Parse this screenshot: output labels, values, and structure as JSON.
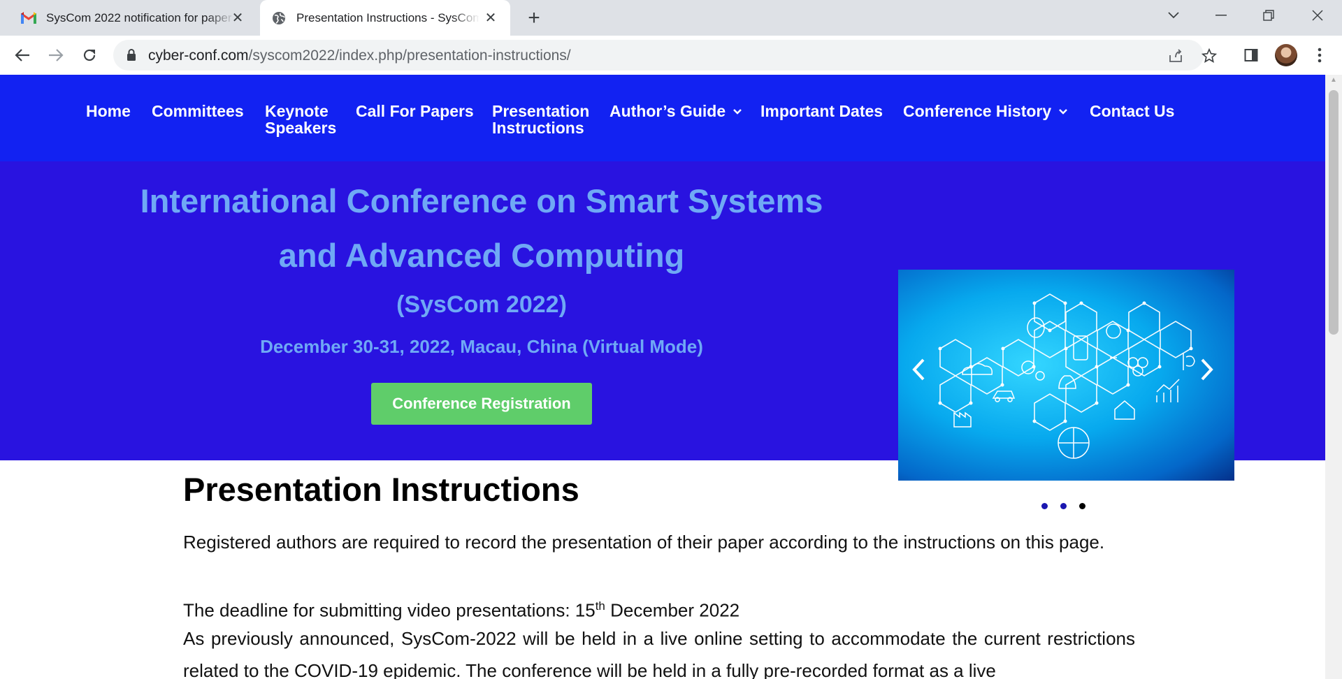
{
  "browser": {
    "tabs": [
      {
        "title": "SysCom 2022 notification for paper",
        "active": false,
        "icon": "gmail-icon"
      },
      {
        "title": "Presentation Instructions - SysCom",
        "active": true,
        "icon": "globe-icon"
      }
    ],
    "url_host": "cyber-conf.com",
    "url_path": "/syscom2022/index.php/presentation-instructions/"
  },
  "nav": {
    "items": [
      {
        "label": "Home"
      },
      {
        "label": "Committees"
      },
      {
        "label_line1": "Keynote",
        "label_line2": "Speakers"
      },
      {
        "label": "Call For Papers"
      },
      {
        "label_line1": "Presentation",
        "label_line2": "Instructions"
      },
      {
        "label": "Author’s Guide",
        "dropdown": true
      },
      {
        "label": "Important Dates"
      },
      {
        "label": "Conference History",
        "dropdown": true
      },
      {
        "label": "Contact Us"
      }
    ]
  },
  "hero": {
    "title_line1": "International Conference on Smart Systems",
    "title_line2": "and Advanced Computing",
    "subtitle": "(SysCom 2022)",
    "dates": "December 30-31, 2022, Macau, China (Virtual Mode)",
    "register_label": "Conference Registration",
    "slider": {
      "slides": 3,
      "active_slide": 3
    }
  },
  "content": {
    "heading": "Presentation Instructions",
    "p1": "Registered authors are required to record the presentation of their paper according to the instructions on this page.",
    "p2_prefix": "The deadline for submitting video presentations: 15",
    "p2_sup": "th",
    "p2_suffix": " December 2022",
    "p3": "As previously announced, SysCom-2022 will be held in a live online setting to accommodate the current restrictions related to the COVID-19 epidemic. The conference will be held in a fully pre-recorded format as a live"
  },
  "colors": {
    "nav_bg": "#1222f2",
    "hero_bg": "#2913e0",
    "hero_text": "#6fa9f5",
    "button_green": "#5fcd6a"
  }
}
